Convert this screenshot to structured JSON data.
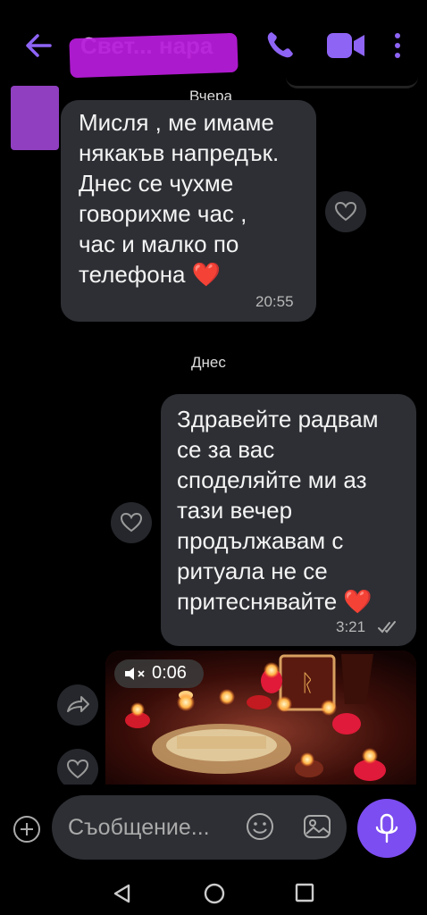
{
  "header": {
    "title": "Свет... нара",
    "back_icon": "arrow-left-icon",
    "actions": [
      "phone-icon",
      "video-camera-icon",
      "more-vertical-icon"
    ],
    "accent": "#7c4df0"
  },
  "dates": {
    "yesterday": "Вчера",
    "today": "Днес"
  },
  "messages": {
    "incoming_1": {
      "lines": [
        "Мисля , ме имаме",
        "някакъв напредък.",
        "Днес се чухме",
        "говорихме час ,",
        "час и малко по",
        "телефона ❤️"
      ],
      "time": "20:55"
    },
    "outgoing_1": {
      "lines": [
        "Здравейте радвам",
        "се за вас",
        "споделяйте ми аз",
        "тази вечер",
        "продължавам с",
        "ритуала не се",
        "притеснявайте ❤️"
      ],
      "time": "3:21",
      "status": "read"
    },
    "video": {
      "duration": "0:06",
      "muted_icon": "speaker-muted-icon"
    }
  },
  "input": {
    "placeholder": "Съобщение..."
  },
  "nav": [
    "back-triangle-icon",
    "home-circle-icon",
    "recent-square-icon"
  ]
}
